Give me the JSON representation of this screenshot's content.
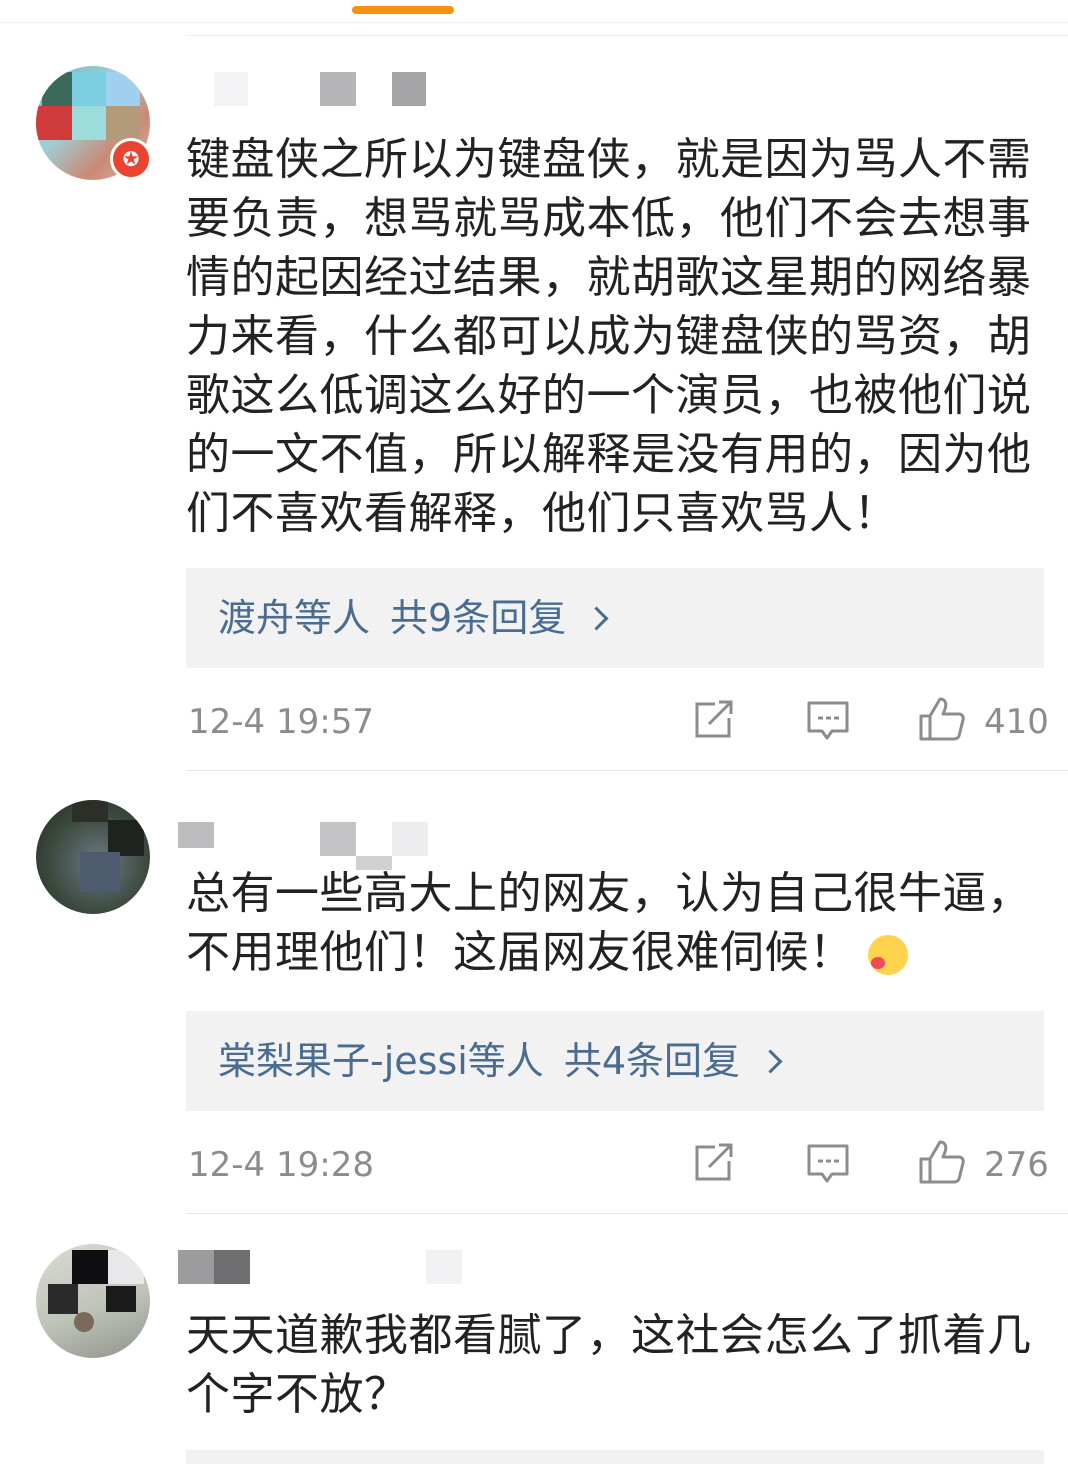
{
  "colors": {
    "accent": "#f59211",
    "link": "#4a6c91",
    "text": "#222222",
    "meta": "#8c8c8c",
    "reply_bg": "#f2f2f2",
    "vip_badge": "#e8442f"
  },
  "comments": [
    {
      "text": "键盘侠之所以为键盘侠，就是因为骂人不需要负责，想骂就骂成本低，他们不会去想事情的起因经过结果，就胡歌这星期的网络暴力来看，什么都可以成为键盘侠的骂资，胡歌这么低调这么好的一个演员，也被他们说的一文不值，所以解释是没有用的，因为他们不喜欢看解释，他们只喜欢骂人！",
      "reply_users": "渡舟等人",
      "reply_count": "共9条回复",
      "time": "12-4 19:57",
      "likes": "410",
      "icons": {
        "share": "share-icon",
        "comment": "comment-icon",
        "like": "thumbs-up-icon",
        "badge": "vip-star-badge"
      }
    },
    {
      "text": "总有一些高大上的网友，认为自己很牛逼，不用理他们！这届网友很难伺候！",
      "reply_users": "棠梨果子-jessi等人",
      "reply_count": "共4条回复",
      "time": "12-4 19:28",
      "likes": "276",
      "icons": {
        "emoji": "hug-emoji",
        "share": "share-icon",
        "comment": "comment-icon",
        "like": "thumbs-up-icon"
      }
    },
    {
      "text": "天天道歉我都看腻了，这社会怎么了抓着几个字不放？"
    }
  ]
}
